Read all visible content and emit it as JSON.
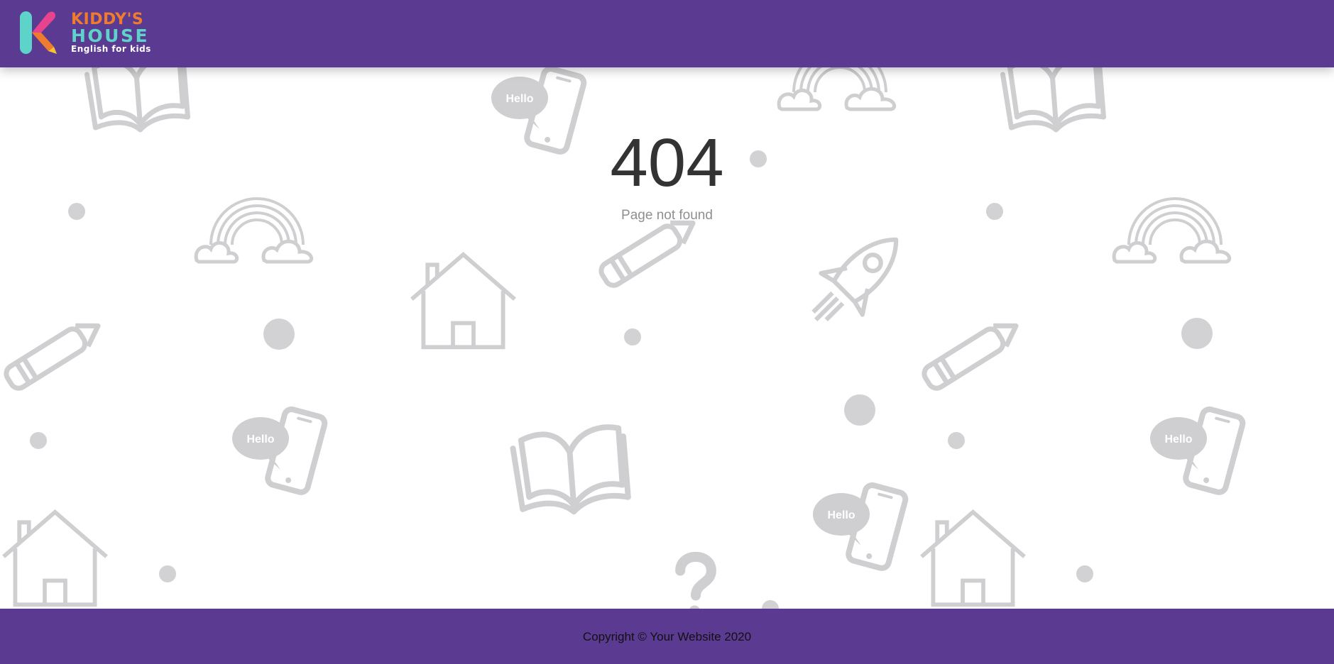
{
  "brand": {
    "line1": "KIDDY'S",
    "line2": "HOUSE",
    "line3": "English for kids",
    "colors": {
      "purple": "#5b3a91",
      "orange": "#ef7b2e",
      "teal": "#5ed3c9",
      "pink": "#e8438e",
      "yellow": "#f6c330"
    }
  },
  "error": {
    "code": "404",
    "message": "Page not found"
  },
  "pattern": {
    "bubble_text": "Hello",
    "icons": [
      "book-icon",
      "phone-hello-icon",
      "rainbow-icon",
      "pencil-icon",
      "house-icon",
      "rocket-icon",
      "question-mark-icon",
      "dot"
    ]
  },
  "footer": {
    "copyright": "Copyright © Your Website 2020"
  }
}
